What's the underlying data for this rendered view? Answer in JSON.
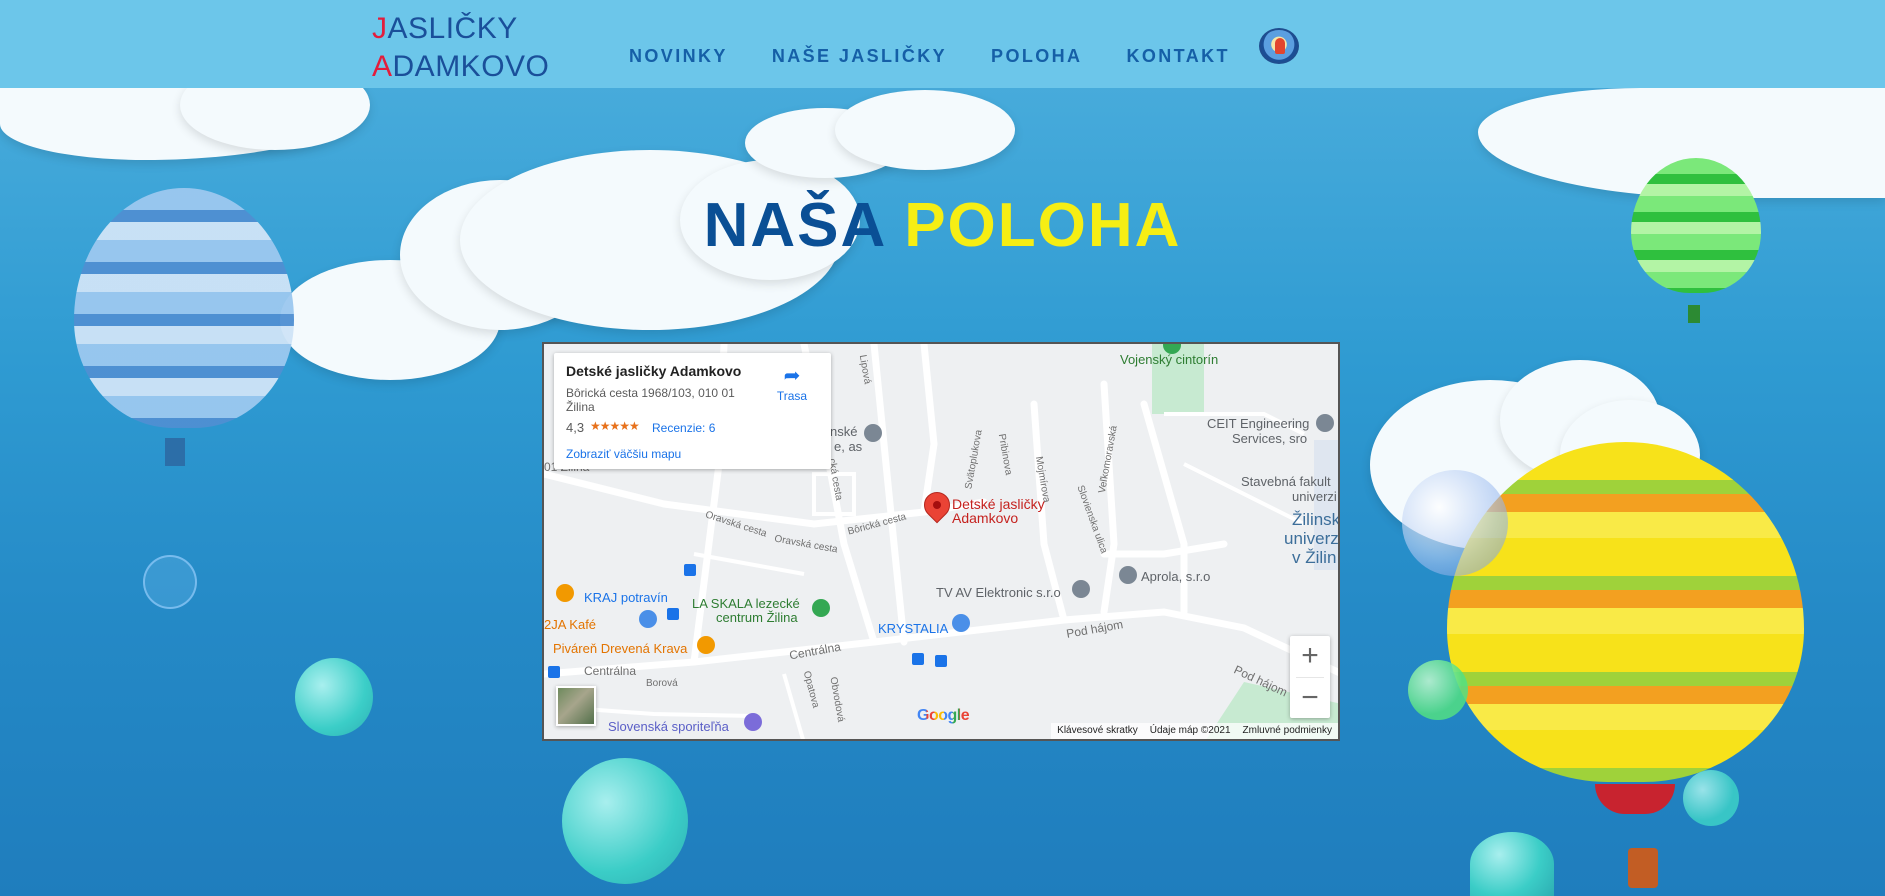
{
  "header": {
    "logo_line1_initial": "J",
    "logo_line1_rest": "ASLIČKY",
    "logo_line2_initial": "A",
    "logo_line2_rest": "DAMKOVO",
    "nav": [
      {
        "label": "NOVINKY"
      },
      {
        "label": "NAŠE JASLIČKY"
      },
      {
        "label": "POLOHA"
      },
      {
        "label": "KONTAKT"
      }
    ]
  },
  "page": {
    "title_word1": "NAŠA",
    "title_word2": "POLOHA"
  },
  "map": {
    "card": {
      "name": "Detské jasličky Adamkovo",
      "address": "Bôrická cesta 1968/103, 010 01 Žilina",
      "rating": "4,3",
      "stars": "★★★★★",
      "reviews": "Recenzie: 6",
      "bigger_map": "Zobraziť väčšiu mapu",
      "directions": "Trasa"
    },
    "marker_label_1": "Detské jasličky",
    "marker_label_2": "Adamkovo",
    "streets": {
      "lipova": "Lipová",
      "oravska1": "Oravská cesta",
      "oravska2": "Oravská cesta",
      "boricka": "Bôrická cesta",
      "svatoplukova": "Svätoplukova",
      "pribinova": "Pribinova",
      "mojmirova": "Mojmírova",
      "velkomoravska": "Veľkomoravská",
      "slovienska": "Slovienska ulica",
      "centralna1": "Centrálna",
      "centralna2": "Centrálna",
      "pod_hajom1": "Pod hájom",
      "pod_hajom2": "Pod hájom",
      "borova": "Borová",
      "opatova": "Opatova",
      "obvodova": "Obvodová",
      "cka": "cká cesta",
      "zilina_frag": "01 Žilina"
    },
    "pois": {
      "vojensky": "Vojenský cintorín",
      "ceit1": "CEIT Engineering",
      "ceit2": "Services, sro",
      "stavebna1": "Stavebná fakult",
      "stavebna2": "univerzi",
      "zilinska1": "Žilinsk",
      "zilinska2": "univerz",
      "zilinska3": "v Žilin",
      "aprola": "Aprola, s.r.o",
      "tvav": "TV AV Elektronic s.r.o",
      "krystalia": "KRYSTALIA",
      "kraj": "KRAJ potravín",
      "laskala1": "LA SKALA lezecké",
      "laskala2": "centrum Žilina",
      "zja": "2JA Kafé",
      "pivaren": "Piváreň Drevená Krava",
      "sporitelna": "Slovenská sporiteľňa",
      "nske1": "nské",
      "nske2": "e, as"
    },
    "zoom_in": "+",
    "zoom_out": "−",
    "google": "Google",
    "footer": {
      "shortcuts": "Klávesové skratky",
      "data": "Údaje máp ©2021",
      "terms": "Zmluvné podmienky"
    }
  },
  "colors": {
    "header_bg": "#6cc6ea",
    "logo_initial": "#e31d3c",
    "logo_text": "#1a4f9a",
    "nav_text": "#155fa7",
    "title_word1": "#0a4f95",
    "title_word2": "#f6ee14",
    "marker": "#ea4335",
    "link": "#1a73e8"
  }
}
